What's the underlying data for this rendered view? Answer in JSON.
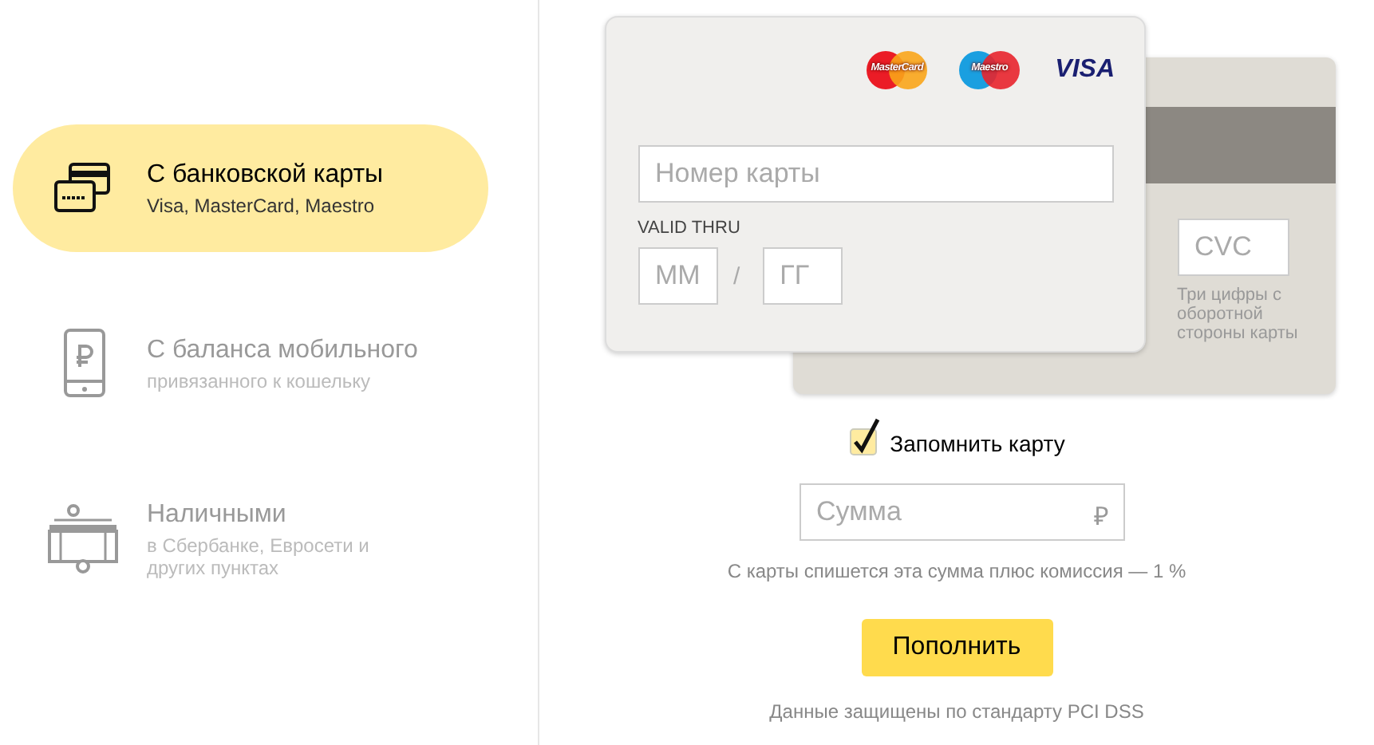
{
  "methods": [
    {
      "kind": "card",
      "title": "С банковской карты",
      "subtitle": "Visa, MasterCard, Maestro",
      "selected": true
    },
    {
      "kind": "phone",
      "title": "С баланса мобильного",
      "subtitle": "привязанного к кошельку",
      "selected": false
    },
    {
      "kind": "cash",
      "title": "Наличными",
      "subtitle": "в Сбербанке, Евросети и других пунктах",
      "selected": false
    }
  ],
  "card_front": {
    "logos": [
      {
        "kind": "mastercard",
        "label": "MasterCard"
      },
      {
        "kind": "maestro",
        "label": "Maestro"
      },
      {
        "kind": "visa",
        "label": "VISA"
      }
    ],
    "number_placeholder": "Номер карты",
    "valid_label": "VALID THRU",
    "month_placeholder": "ММ",
    "separator": "/",
    "year_placeholder": "ГГ"
  },
  "card_back": {
    "cvc_placeholder": "CVC",
    "cvc_hint": "Три цифры с оборотной стороны карты"
  },
  "remember": {
    "label": "Запомнить карту",
    "checked": true
  },
  "amount": {
    "placeholder": "Сумма",
    "currency": "₽"
  },
  "commission_note": "С карты спишется эта сумма плюс комиссия — 1 %",
  "submit": "Пополнить",
  "security_note": "Данные защищены по стандарту PCI DSS"
}
